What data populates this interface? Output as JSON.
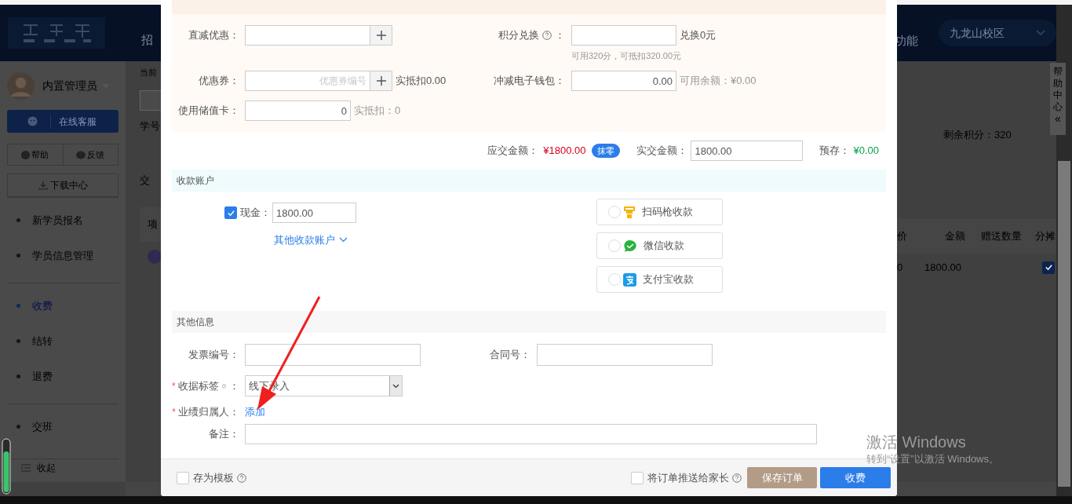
{
  "app_header": {
    "nav_left": "招",
    "nav_right": "功能",
    "campus": "九龙山校区"
  },
  "sidebar": {
    "user": "内置管理员",
    "service_button": "在线客服",
    "help": "帮助",
    "feedback": "反馈",
    "download": "下载中心",
    "menu_groups": [
      {
        "items": [
          {
            "label": "新学员报名",
            "selected": false
          },
          {
            "label": "学员信息管理",
            "selected": false
          }
        ]
      },
      {
        "items": [
          {
            "label": "收费",
            "selected": true
          },
          {
            "label": "结转",
            "selected": false
          },
          {
            "label": "退费",
            "selected": false
          }
        ]
      },
      {
        "items": [
          {
            "label": "交班",
            "selected": false
          }
        ]
      }
    ],
    "collapse": "收起"
  },
  "background_page": {
    "breadcrumb": "当前",
    "student_label": "学号",
    "tab_label": "交",
    "table_header_left": "项",
    "remaining_points": "剩余积分：320",
    "table_columns": [
      "价",
      "金额",
      "赠送数量",
      "分摊"
    ],
    "row": {
      "price": "0",
      "amount": "1800.00",
      "split_checked": true
    }
  },
  "help_center": {
    "label": "帮助中心",
    "icon": "«"
  },
  "modal": {
    "direct_discount": {
      "label": "直减优惠："
    },
    "points": {
      "label": "积分兑换",
      "label_end": "：",
      "result": "兑换0元",
      "hint": "可用320分，可抵扣320.00元"
    },
    "coupon": {
      "label": "优惠券：",
      "placeholder": "优惠券编号",
      "result": "实抵扣0.00"
    },
    "wallet": {
      "label": "冲减电子钱包：",
      "value": "0.00",
      "result": "可用余额：¥0.00"
    },
    "stored_card": {
      "label": "使用储值卡：",
      "value": "0",
      "result": "实抵扣：0"
    },
    "totals": {
      "due_label": "应交金额：",
      "due": "¥1800.00",
      "round_button": "抹零",
      "paid_label": "实交金额：",
      "paid": "1800.00",
      "prepay_label": "预存：",
      "prepay": "¥0.00"
    },
    "payment": {
      "title": "收款账户",
      "cash": {
        "checked": true,
        "label": "现金：",
        "value": "1800.00"
      },
      "other_link": "其他收款账户",
      "methods": [
        {
          "kind": "scanner",
          "label": "扫码枪收款",
          "selected": false
        },
        {
          "kind": "wechat",
          "label": "微信收款",
          "selected": false
        },
        {
          "kind": "alipay",
          "label": "支付宝收款",
          "selected": false
        }
      ]
    },
    "other_info": {
      "title": "其他信息",
      "invoice_label": "发票编号：",
      "contract_label": "合同号：",
      "receipt_tag": {
        "required_mark": "*",
        "label": "收据标签",
        "label_end": "：",
        "value": "线下录入"
      },
      "performance_owner": {
        "required_mark": "*",
        "label": "业绩归属人：",
        "link": "添加"
      },
      "remark_label": "备注："
    },
    "footer": {
      "save_template": {
        "checked": false,
        "label": "存为模板"
      },
      "push_parent": {
        "checked": false,
        "label": "将订单推送给家长"
      },
      "buttons": [
        {
          "kind": "secondary",
          "label": "保存订单"
        },
        {
          "kind": "primary",
          "label": "收费"
        }
      ]
    }
  },
  "windows_activation": {
    "title": "激活 Windows",
    "subtitle": "转到“设置”以激活 Windows。"
  }
}
